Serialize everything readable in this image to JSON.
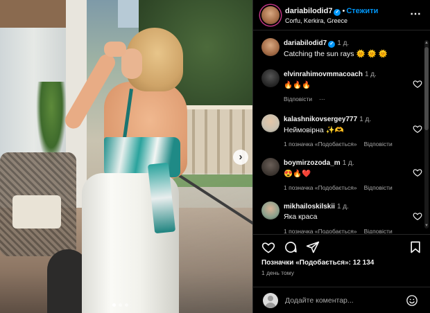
{
  "post": {
    "username": "dariabilodid7",
    "follow_label": "Стежити",
    "location": "Corfu, Kerkira, Greece",
    "caption": {
      "username": "dariabilodid7",
      "time": "1 д.",
      "text": "Catching the sun rays 🌞 🌞 🌞"
    }
  },
  "comments": [
    {
      "username": "elvinrahimovmmacoach",
      "time": "1 д.",
      "text": "🔥🔥🔥",
      "meta": [
        "Відповісти",
        "⋯"
      ]
    },
    {
      "username": "kalashnikovsergey777",
      "time": "1 д.",
      "text": "Неймовірна ✨🫶",
      "meta": [
        "1 позначка «Подобається»",
        "Відповісти"
      ]
    },
    {
      "username": "boymirzozoda_m",
      "time": "1 д.",
      "text": "😍🔥❤️",
      "meta": [
        "1 позначка «Подобається»",
        "Відповісти"
      ]
    },
    {
      "username": "mikhailoskilskii",
      "time": "1 д.",
      "text": "Яка краса",
      "meta": [
        "1 позначка «Подобається»",
        "Відповісти"
      ]
    }
  ],
  "stats": {
    "likes": "Позначки «Подобається»: 12 134",
    "time_ago": "1 день тому"
  },
  "add_comment": {
    "placeholder": "Додайте коментар..."
  },
  "icons": {
    "more": "more-icon",
    "like": "heart-icon",
    "comment": "comment-icon",
    "share": "share-icon",
    "save": "bookmark-icon",
    "emoji": "emoji-icon",
    "carousel_next": "chevron-right-icon"
  },
  "colors": {
    "accent": "#0095f6",
    "background": "#000000",
    "muted_text": "#a8a8a8"
  }
}
